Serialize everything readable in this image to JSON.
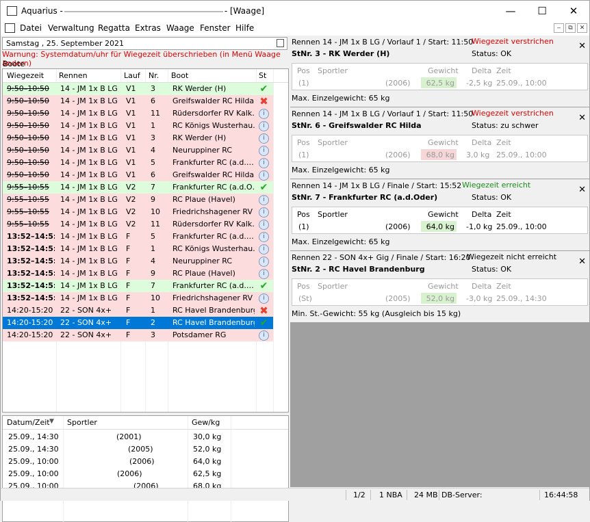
{
  "window": {
    "app_name": "Aquarius -",
    "title_suffix": "- [Waage]",
    "minimize": "—",
    "maximize": "☐",
    "close": "✕"
  },
  "menu": [
    "Datei",
    "Verwaltung",
    "Regatta",
    "Extras",
    "Waage",
    "Fenster",
    "Hilfe"
  ],
  "mdi_buttons": [
    "‒",
    "⧉",
    "✕"
  ],
  "date": "Samstag   , 25. September 2021",
  "warning": "Warnung: Systemdatum/uhr für Wiegezeit überschrieben (in Menü Waage ändern)",
  "boats_label": "Boote",
  "grid_headers": [
    "Wiegezeit",
    "Rennen",
    "Lauf",
    "Nr.",
    "Boot",
    "St"
  ],
  "rows": [
    {
      "time": "9:50–10:50",
      "race": "14 - JM 1x B LG",
      "heat": "V1",
      "nr": "3",
      "boat": "RK Werder (H)",
      "st": "ok",
      "color": "green",
      "strike": true,
      "bold": false
    },
    {
      "time": "9:50–10:50",
      "race": "14 - JM 1x B LG",
      "heat": "V1",
      "nr": "6",
      "boat": "Greifswalder RC Hilda",
      "st": "x",
      "color": "pink",
      "strike": true,
      "bold": false
    },
    {
      "time": "9:50–10:50",
      "race": "14 - JM 1x B LG",
      "heat": "V1",
      "nr": "11",
      "boat": "Rüdersdorfer RV Kalk…",
      "st": "i",
      "color": "pink",
      "strike": true,
      "bold": false
    },
    {
      "time": "9:50–10:50",
      "race": "14 - JM 1x B LG",
      "heat": "V1",
      "nr": "1",
      "boat": "RC Königs Wusterhau…",
      "st": "i",
      "color": "pink",
      "strike": true,
      "bold": false
    },
    {
      "time": "9:50–10:50",
      "race": "14 - JM 1x B LG",
      "heat": "V1",
      "nr": "3",
      "boat": "RK Werder (H)",
      "st": "i",
      "color": "pink",
      "strike": true,
      "bold": false
    },
    {
      "time": "9:50–10:50",
      "race": "14 - JM 1x B LG",
      "heat": "V1",
      "nr": "4",
      "boat": "Neuruppiner RC",
      "st": "i",
      "color": "pink",
      "strike": true,
      "bold": false
    },
    {
      "time": "9:50–10:50",
      "race": "14 - JM 1x B LG",
      "heat": "V1",
      "nr": "5",
      "boat": "Frankfurter RC (a.d.…",
      "st": "i",
      "color": "pink",
      "strike": true,
      "bold": false
    },
    {
      "time": "9:50–10:50",
      "race": "14 - JM 1x B LG",
      "heat": "V1",
      "nr": "6",
      "boat": "Greifswalder RC Hilda",
      "st": "i",
      "color": "pink",
      "strike": true,
      "bold": false
    },
    {
      "time": "9:55–10:55",
      "race": "14 - JM 1x B LG",
      "heat": "V2",
      "nr": "7",
      "boat": "Frankfurter RC (a.d.O…",
      "st": "ok",
      "color": "green",
      "strike": true,
      "bold": false
    },
    {
      "time": "9:55–10:55",
      "race": "14 - JM 1x B LG",
      "heat": "V2",
      "nr": "9",
      "boat": "RC Plaue (Havel)",
      "st": "i",
      "color": "pink",
      "strike": true,
      "bold": false
    },
    {
      "time": "9:55–10:55",
      "race": "14 - JM 1x B LG",
      "heat": "V2",
      "nr": "10",
      "boat": "Friedrichshagener RV",
      "st": "i",
      "color": "pink",
      "strike": true,
      "bold": false
    },
    {
      "time": "9:55–10:55",
      "race": "14 - JM 1x B LG",
      "heat": "V2",
      "nr": "11",
      "boat": "Rüdersdorfer RV Kalk…",
      "st": "i",
      "color": "pink",
      "strike": true,
      "bold": false
    },
    {
      "time": "13:52–14:5:",
      "race": "14 - JM 1x B LG",
      "heat": "F",
      "nr": "5",
      "boat": "Frankfurter RC (a.d.…",
      "st": "i",
      "color": "pink",
      "strike": false,
      "bold": true
    },
    {
      "time": "13:52–14:5:",
      "race": "14 - JM 1x B LG",
      "heat": "F",
      "nr": "1",
      "boat": "RC Königs Wusterhau…",
      "st": "i",
      "color": "pink",
      "strike": false,
      "bold": true
    },
    {
      "time": "13:52–14:5:",
      "race": "14 - JM 1x B LG",
      "heat": "F",
      "nr": "4",
      "boat": "Neuruppiner RC",
      "st": "i",
      "color": "pink",
      "strike": false,
      "bold": true
    },
    {
      "time": "13:52–14:5:",
      "race": "14 - JM 1x B LG",
      "heat": "F",
      "nr": "9",
      "boat": "RC Plaue (Havel)",
      "st": "i",
      "color": "pink",
      "strike": false,
      "bold": true
    },
    {
      "time": "13:52–14:5:",
      "race": "14 - JM 1x B LG",
      "heat": "F",
      "nr": "7",
      "boat": "Frankfurter RC (a.d.…",
      "st": "ok",
      "color": "green",
      "strike": false,
      "bold": true
    },
    {
      "time": "13:52–14:5:",
      "race": "14 - JM 1x B LG",
      "heat": "F",
      "nr": "10",
      "boat": "Friedrichshagener RV",
      "st": "i",
      "color": "pink",
      "strike": false,
      "bold": true
    },
    {
      "time": "14:20-15:20",
      "race": "22 - SON 4x+",
      "heat": "F",
      "nr": "1",
      "boat": "RC Havel Brandenburg",
      "st": "x",
      "color": "pink",
      "strike": false,
      "bold": false
    },
    {
      "time": "14:20-15:20",
      "race": "22 - SON 4x+",
      "heat": "F",
      "nr": "2",
      "boat": "RC Havel Brandenburg",
      "st": "ok",
      "color": "sel",
      "strike": false,
      "bold": false
    },
    {
      "time": "14:20-15:20",
      "race": "22 - SON 4x+",
      "heat": "F",
      "nr": "3",
      "boat": "Potsdamer RG",
      "st": "i",
      "color": "pink",
      "strike": false,
      "bold": false
    }
  ],
  "weighings_headers": [
    "Datum/Zeit",
    "Sportler",
    "Gew/kg"
  ],
  "weighings": [
    {
      "dt": "25.09., 14:30",
      "sp": "(2001)",
      "kg": "30,0 kg"
    },
    {
      "dt": "25.09., 14:30",
      "sp": "(2005)",
      "kg": "52,0 kg"
    },
    {
      "dt": "25.09., 10:00",
      "sp": "(2006)",
      "kg": "64,0 kg"
    },
    {
      "dt": "25.09., 10:00",
      "sp": "(2006)",
      "kg": "62,5 kg"
    },
    {
      "dt": "25.09., 10:00",
      "sp": "(2006)",
      "kg": "68,0 kg"
    }
  ],
  "cards": [
    {
      "race": "Rennen 14 - JM 1x B LG  / Vorlauf 1 / Start: 11:50",
      "state": "Wiegezeit verstrichen",
      "state_color": "#e00000",
      "stnr": "StNr. 3 - RK Werder (H)",
      "status": "Status: OK",
      "cols": [
        "Pos",
        "Sportler",
        "Gewicht",
        "Delta",
        "Zeit"
      ],
      "pos": "(1)",
      "year": "(2006)",
      "weight": "62,5 kg",
      "delta": "-2,5 kg",
      "time": "25.09., 10:00",
      "greyed": true,
      "hl": "green",
      "footer": "Max. Einzelgewicht: 65 kg"
    },
    {
      "race": "Rennen 14 - JM 1x B LG  / Vorlauf 1 / Start: 11:50",
      "state": "Wiegezeit verstrichen",
      "state_color": "#e00000",
      "stnr": "StNr. 6 - Greifswalder RC Hilda",
      "status": "Status: zu schwer",
      "cols": [
        "Pos",
        "Sportler",
        "Gewicht",
        "Delta",
        "Zeit"
      ],
      "pos": "(1)",
      "year": "(2006)",
      "weight": "68,0 kg",
      "delta": "3,0 kg",
      "time": "25.09., 10:00",
      "greyed": true,
      "hl": "pink",
      "footer": "Max. Einzelgewicht: 65 kg"
    },
    {
      "race": "Rennen 14 - JM 1x B LG  / Finale / Start: 15:52",
      "state": "Wiegezeit erreicht",
      "state_color": "#1a8a1a",
      "stnr": "StNr. 7 - Frankfurter RC (a.d.Oder)",
      "status": "Status: OK",
      "cols": [
        "Pos",
        "Sportler",
        "Gewicht",
        "Delta",
        "Zeit"
      ],
      "pos": "(1)",
      "year": "(2006)",
      "weight": "64,0 kg",
      "delta": "-1,0 kg",
      "time": "25.09., 10:00",
      "greyed": false,
      "hl": "green",
      "footer": "Max. Einzelgewicht: 65 kg"
    },
    {
      "race": "Rennen 22 - SON 4x+ Gig / Finale / Start: 16:20",
      "state": "Wiegezeit nicht erreicht",
      "state_color": "#000000",
      "stnr": "StNr. 2 - RC Havel Brandenburg",
      "status": "Status: OK",
      "cols": [
        "Pos",
        "Sportler",
        "Gewicht",
        "Delta",
        "Zeit"
      ],
      "pos": "(St)",
      "year": "(2005)",
      "weight": "52,0 kg",
      "delta": "-3,0 kg",
      "time": "25.09., 14:30",
      "greyed": true,
      "hl": "green",
      "footer": "Min. St.-Gewicht: 55 kg (Ausgleich bis 15 kg)"
    }
  ],
  "status_bar": {
    "page": "1/2",
    "nba": "1 NBA",
    "mem": "24 MB",
    "db": "DB-Server:",
    "clock": "16:44:58"
  },
  "colors": {
    "selection": "#0078d7",
    "late": "#fcdcdc",
    "ok": "#dcfcdc",
    "warning": "#e00000"
  }
}
